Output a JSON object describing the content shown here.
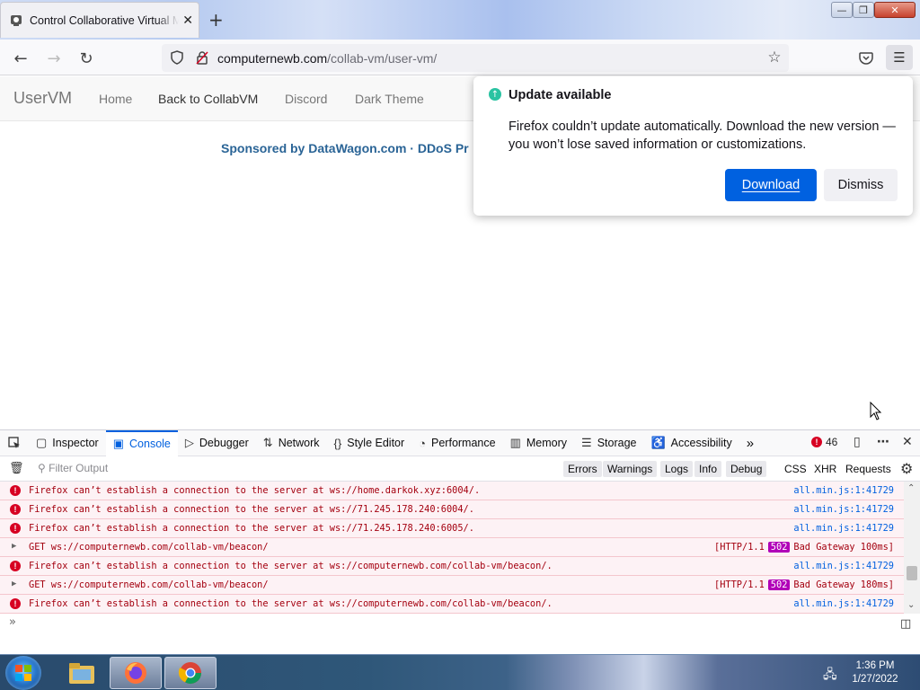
{
  "browser": {
    "tab_title": "Control Collaborative Virtual Machines!",
    "url_domain": "computernewb.com",
    "url_path": "/collab-vm/user-vm/"
  },
  "site": {
    "brand": "UserVM",
    "nav": [
      "Home",
      "Back to CollabVM",
      "Discord",
      "Dark Theme"
    ],
    "sponsor": "Sponsored by DataWagon.com · DDoS Pr"
  },
  "update_popup": {
    "title": "Update available",
    "body": "Firefox couldn’t update automatically. Download the new version — you won’t lose saved information or customizations.",
    "download_label": "Download",
    "dismiss_label": "Dismiss",
    "accent": "#0061e0"
  },
  "devtools": {
    "tabs": [
      {
        "label": "Inspector",
        "icon": "inspector-icon"
      },
      {
        "label": "Console",
        "icon": "console-icon"
      },
      {
        "label": "Debugger",
        "icon": "debugger-icon"
      },
      {
        "label": "Network",
        "icon": "network-icon"
      },
      {
        "label": "Style Editor",
        "icon": "style-editor-icon"
      },
      {
        "label": "Performance",
        "icon": "performance-icon"
      },
      {
        "label": "Memory",
        "icon": "memory-icon"
      },
      {
        "label": "Storage",
        "icon": "storage-icon"
      },
      {
        "label": "Accessibility",
        "icon": "accessibility-icon"
      }
    ],
    "active_tab": "Console",
    "error_count": "46",
    "filter_placeholder": "Filter Output",
    "filters": [
      "Errors",
      "Warnings",
      "Logs",
      "Info",
      "Debug"
    ],
    "types": [
      "CSS",
      "XHR",
      "Requests"
    ],
    "log": [
      {
        "kind": "error",
        "msg": "Firefox can’t establish a connection to the server at ws://home.darkok.xyz:6004/.",
        "src": "all.min.js:1:41729"
      },
      {
        "kind": "error",
        "msg": "Firefox can’t establish a connection to the server at ws://71.245.178.240:6004/.",
        "src": "all.min.js:1:41729"
      },
      {
        "kind": "error",
        "msg": "Firefox can’t establish a connection to the server at ws://71.245.178.240:6005/.",
        "src": "all.min.js:1:41729"
      },
      {
        "kind": "net",
        "msg": "GET ws://computernewb.com/collab-vm/beacon/",
        "proto": "[HTTP/1.1",
        "status": "502",
        "status_text": "Bad Gateway 100ms]"
      },
      {
        "kind": "error",
        "msg": "Firefox can’t establish a connection to the server at ws://computernewb.com/collab-vm/beacon/.",
        "src": "all.min.js:1:41729"
      },
      {
        "kind": "net",
        "msg": "GET ws://computernewb.com/collab-vm/beacon/",
        "proto": "[HTTP/1.1",
        "status": "502",
        "status_text": "Bad Gateway 180ms]"
      },
      {
        "kind": "error",
        "msg": "Firefox can’t establish a connection to the server at ws://computernewb.com/collab-vm/beacon/.",
        "src": "all.min.js:1:41729"
      }
    ]
  },
  "taskbar": {
    "time": "1:36 PM",
    "date": "1/27/2022"
  }
}
